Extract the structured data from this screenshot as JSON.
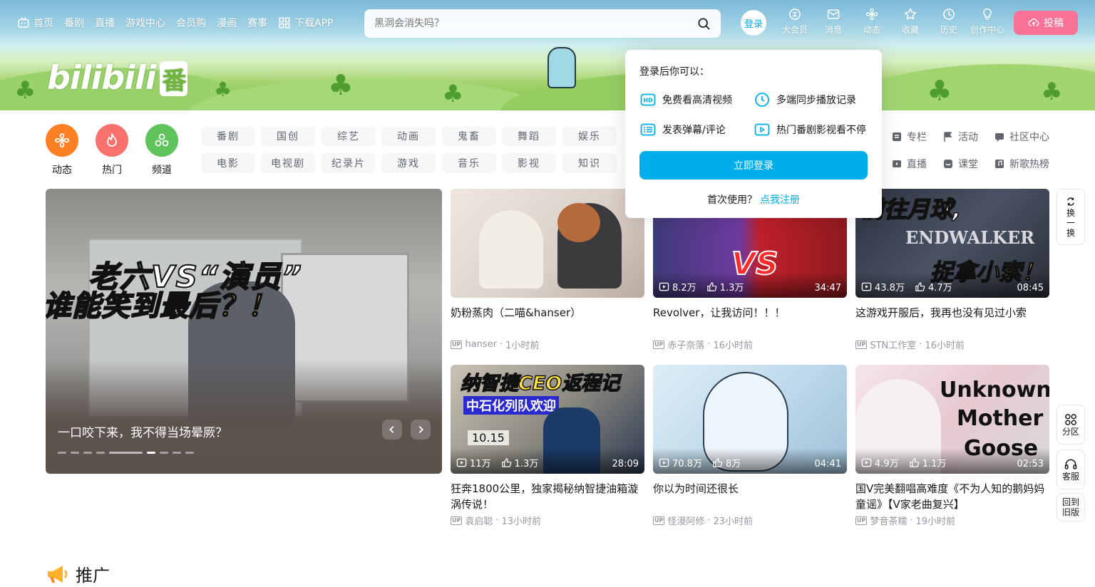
{
  "nav": {
    "left": [
      {
        "label": "首页",
        "icon": "tv-icon"
      },
      {
        "label": "番剧"
      },
      {
        "label": "直播"
      },
      {
        "label": "游戏中心"
      },
      {
        "label": "会员购"
      },
      {
        "label": "漫画"
      },
      {
        "label": "赛事"
      },
      {
        "label": "下载APP",
        "icon": "grid-icon"
      }
    ],
    "search_placeholder": "黑洞会消失吗？",
    "login": "登录",
    "right": [
      {
        "label": "大会员",
        "icon": "vip-icon"
      },
      {
        "label": "消息",
        "icon": "mail-icon"
      },
      {
        "label": "动态",
        "icon": "fan-icon"
      },
      {
        "label": "收藏",
        "icon": "star-icon"
      },
      {
        "label": "历史",
        "icon": "clock-icon"
      },
      {
        "label": "创作中心",
        "icon": "bulb-icon"
      }
    ],
    "upload": "投稿"
  },
  "banner": {
    "logo_text": "bilibili",
    "logo_badge": "番"
  },
  "quick": [
    {
      "label": "动态",
      "color": "#ff7f24"
    },
    {
      "label": "热门",
      "color": "#f9716d"
    },
    {
      "label": "频道",
      "color": "#5ec35a"
    }
  ],
  "categories_row1": [
    "番剧",
    "国创",
    "综艺",
    "动画",
    "鬼畜",
    "舞蹈",
    "娱乐"
  ],
  "categories_row2": [
    "电影",
    "电视剧",
    "纪录片",
    "游戏",
    "音乐",
    "影视",
    "知识"
  ],
  "right_links": [
    {
      "label": "专栏"
    },
    {
      "label": "活动"
    },
    {
      "label": "社区中心"
    },
    {
      "label": "直播"
    },
    {
      "label": "课堂"
    },
    {
      "label": "新歌热榜"
    }
  ],
  "carousel": {
    "title_line1": "老六VS“演员”",
    "title_line2a": "谁能",
    "title_line2b": "笑到最后？！",
    "caption": "一口咬下来，我不得当场晕厥？",
    "dot_count": 10,
    "active_dot": 5
  },
  "videos": [
    {
      "title": "奶粉蒸肉（二喵&hanser）",
      "author": "hanser",
      "time": "1小时前",
      "views": "",
      "likes": "",
      "duration": ""
    },
    {
      "title": "Revolver，让我访问！！！",
      "author": "赤子奈落",
      "time": "16小时前",
      "views": "8.2万",
      "likes": "1.3万",
      "duration": "34:47",
      "overlay": "VS"
    },
    {
      "title": "这游戏开服后，我再也没有见过小索",
      "author": "STN工作室",
      "time": "16小时前",
      "views": "43.8万",
      "likes": "4.7万",
      "duration": "08:45",
      "overlay1": "前往月球,",
      "overlay2": "ENDWALKER",
      "overlay3": "捉拿小索！"
    },
    {
      "title": "狂奔1800公里，独家揭秘纳智捷油箱漩涡传说！",
      "author": "袁启聪",
      "time": "13小时前",
      "views": "11万",
      "likes": "1.3万",
      "duration": "28:09",
      "overlay1": "纳智捷CEO返程记",
      "overlay2": "中石化列队欢迎",
      "overlay3": "10.15"
    },
    {
      "title": "你以为时间还很长",
      "author": "怪漫阿修",
      "time": "23小时前",
      "views": "70.8万",
      "likes": "8万",
      "duration": "04:41"
    },
    {
      "title": "国V完美翻唱高难度《不为人知的鹅妈妈童谣》【V家老曲复兴】",
      "author": "梦音茶糯",
      "time": "19小时前",
      "views": "4.9万",
      "likes": "1.1万",
      "duration": "02:53",
      "overlay1": "Unknown",
      "overlay2": "Mother",
      "overlay3": "Goose"
    }
  ],
  "up_badge": "UP",
  "side": {
    "refresh": [
      "换",
      "一",
      "换"
    ],
    "zones": "分区",
    "service": "客服",
    "old": [
      "回到",
      "旧版"
    ]
  },
  "promo": "推广",
  "popup": {
    "heading": "登录后你可以：",
    "features": [
      "免费看高清视频",
      "多端同步播放记录",
      "发表弹幕/评论",
      "热门番剧影视看不停"
    ],
    "button": "立即登录",
    "first_use": "首次使用？",
    "register": "点我注册"
  },
  "colors": {
    "accent": "#00aeec",
    "pink": "#fb7299"
  }
}
